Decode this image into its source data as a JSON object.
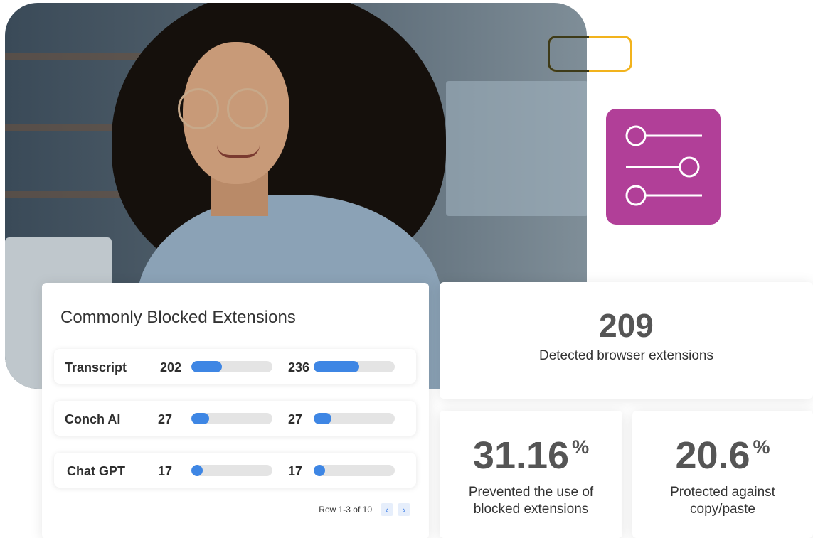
{
  "extensions_card": {
    "title": "Commonly Blocked Extensions",
    "rows": [
      {
        "name": "Transcript",
        "value_a": "202",
        "fill_a": 0.38,
        "value_b": "236",
        "fill_b": 0.56
      },
      {
        "name": "Conch AI",
        "value_a": "27",
        "fill_a": 0.22,
        "value_b": "27",
        "fill_b": 0.22
      },
      {
        "name": "Chat GPT",
        "value_a": "17",
        "fill_a": 0.14,
        "value_b": "17",
        "fill_b": 0.14
      }
    ],
    "pagination": {
      "label": "Row 1-3 of 10",
      "prev_icon": "chevron-left-icon",
      "next_icon": "chevron-right-icon"
    }
  },
  "stats": {
    "detected": {
      "value": "209",
      "label": "Detected browser extensions"
    },
    "prevented": {
      "value": "31.16",
      "unit": "%",
      "label": "Prevented the use of blocked extensions"
    },
    "protected": {
      "value": "20.6",
      "unit": "%",
      "label": "Protected against copy/paste"
    }
  },
  "decor": {
    "settings_icon": "sliders-icon",
    "accent_purple": "#b13f98",
    "accent_yellow": "#f2b31d",
    "bar_blue": "#3e86e4"
  }
}
